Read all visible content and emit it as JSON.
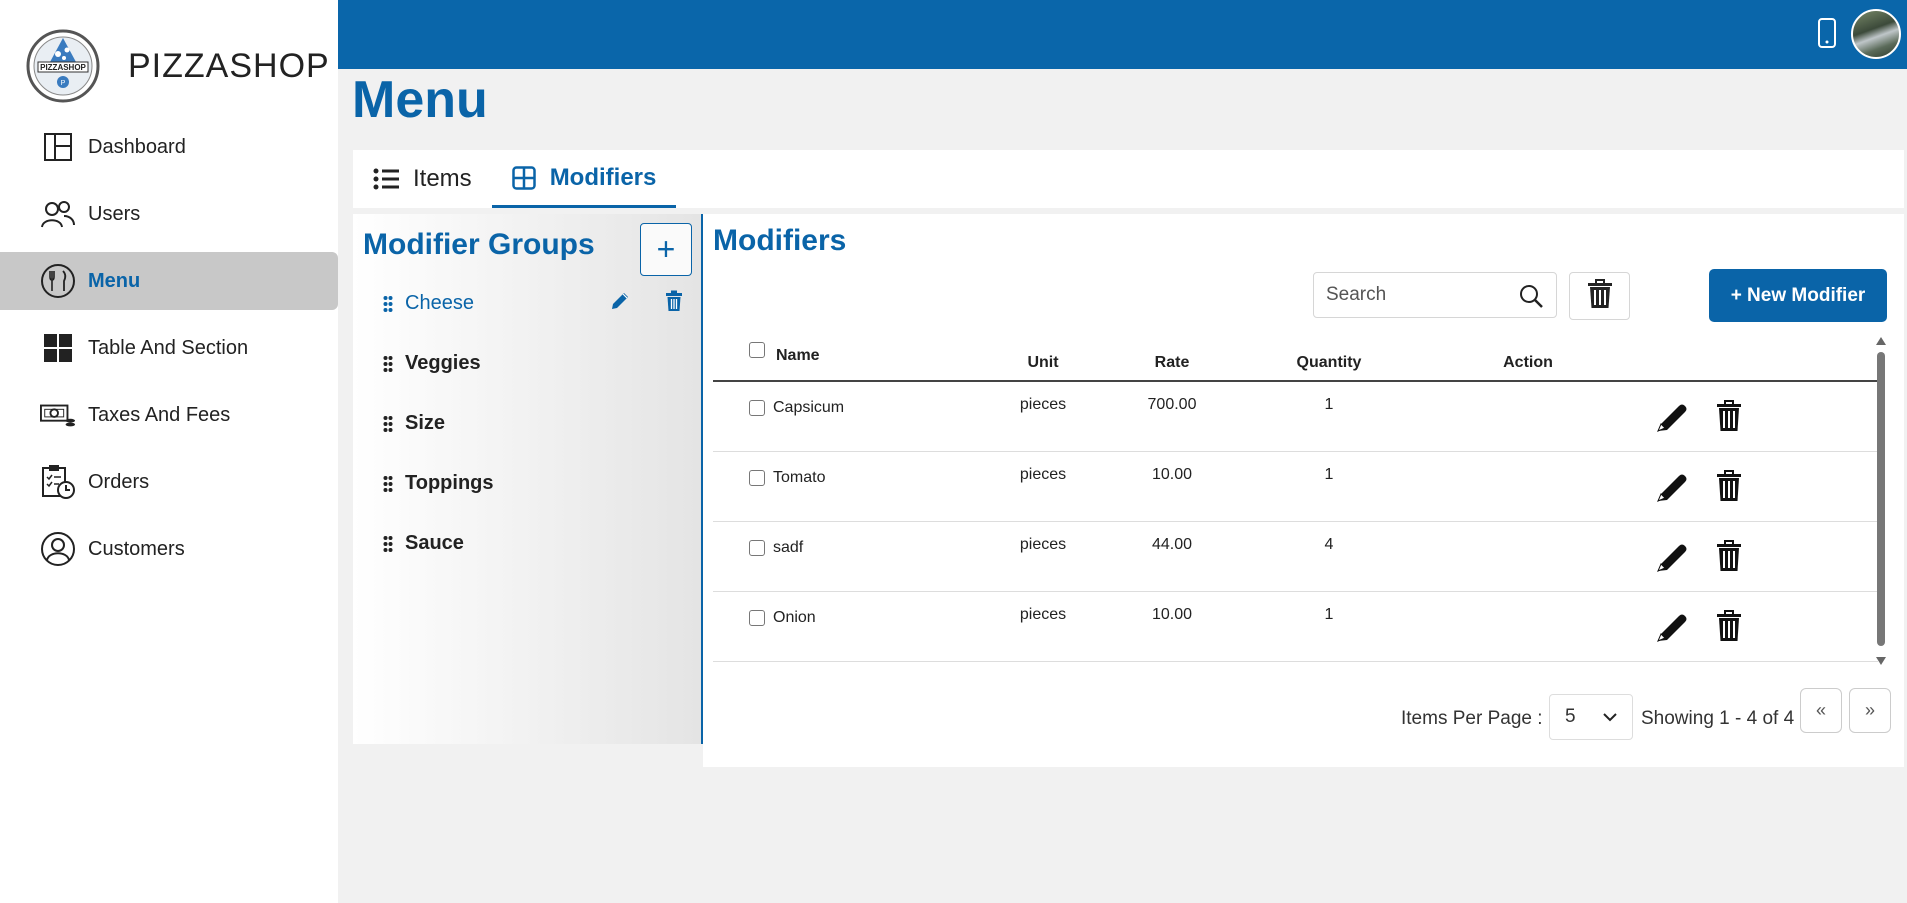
{
  "brand": {
    "name": "PIZZASHOP",
    "logo_text": "PIZZASHOP"
  },
  "sidebar": {
    "items": [
      {
        "label": "Dashboard",
        "icon": "dashboard-icon",
        "active": false
      },
      {
        "label": "Users",
        "icon": "users-icon",
        "active": false
      },
      {
        "label": "Menu",
        "icon": "menu-icon",
        "active": true
      },
      {
        "label": "Table And Section",
        "icon": "table-icon",
        "active": false
      },
      {
        "label": "Taxes And Fees",
        "icon": "taxes-icon",
        "active": false
      },
      {
        "label": "Orders",
        "icon": "orders-icon",
        "active": false
      },
      {
        "label": "Customers",
        "icon": "customers-icon",
        "active": false
      }
    ]
  },
  "page": {
    "title": "Menu"
  },
  "tabs": [
    {
      "label": "Items",
      "active": false
    },
    {
      "label": "Modifiers",
      "active": true
    }
  ],
  "groups": {
    "title": "Modifier Groups",
    "add_label": "+",
    "items": [
      {
        "label": "Cheese",
        "active": true
      },
      {
        "label": "Veggies",
        "active": false
      },
      {
        "label": "Size",
        "active": false
      },
      {
        "label": "Toppings",
        "active": false
      },
      {
        "label": "Sauce",
        "active": false
      }
    ]
  },
  "modifiers": {
    "title": "Modifiers",
    "search_placeholder": "Search",
    "new_label": "+ New Modifier",
    "columns": {
      "name": "Name",
      "unit": "Unit",
      "rate": "Rate",
      "quantity": "Quantity",
      "action": "Action"
    },
    "rows": [
      {
        "name": "Capsicum",
        "unit": "pieces",
        "rate": "700.00",
        "quantity": "1"
      },
      {
        "name": "Tomato",
        "unit": "pieces",
        "rate": "10.00",
        "quantity": "1"
      },
      {
        "name": "sadf",
        "unit": "pieces",
        "rate": "44.00",
        "quantity": "4"
      },
      {
        "name": "Onion",
        "unit": "pieces",
        "rate": "10.00",
        "quantity": "1"
      }
    ]
  },
  "pagination": {
    "per_page_label": "Items Per Page :",
    "per_page_value": "5",
    "showing": "Showing 1 - 4 of 4",
    "prev": "«",
    "next": "»"
  },
  "colors": {
    "primary": "#0a64a8",
    "topbar": "#0a66aa",
    "active_nav_bg": "#c8c8c8"
  }
}
